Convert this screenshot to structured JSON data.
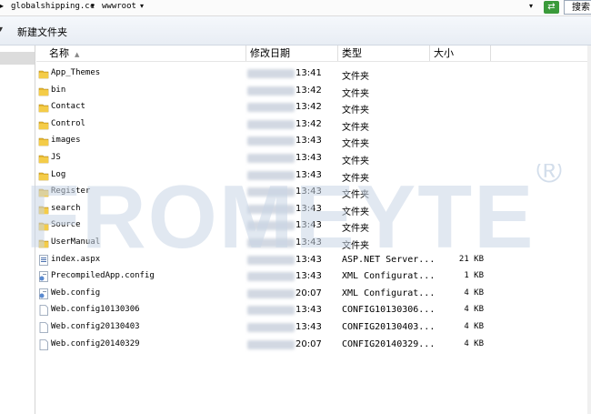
{
  "address": {
    "segments": [
      "globalshipping.cc",
      "wwwroot"
    ],
    "search_label": "搜索"
  },
  "toolbar": {
    "new_folder_label": "新建文件夹"
  },
  "columns": {
    "name": "名称",
    "date": "修改日期",
    "type": "类型",
    "size": "大小"
  },
  "files": [
    {
      "name": "App_Themes",
      "time": "13:41",
      "type": "文件夹",
      "size": "",
      "icon": "folder-icon"
    },
    {
      "name": "bin",
      "time": "13:42",
      "type": "文件夹",
      "size": "",
      "icon": "folder-icon"
    },
    {
      "name": "Contact",
      "time": "13:42",
      "type": "文件夹",
      "size": "",
      "icon": "folder-icon"
    },
    {
      "name": "Control",
      "time": "13:42",
      "type": "文件夹",
      "size": "",
      "icon": "folder-icon"
    },
    {
      "name": "images",
      "time": "13:43",
      "type": "文件夹",
      "size": "",
      "icon": "folder-icon"
    },
    {
      "name": "JS",
      "time": "13:43",
      "type": "文件夹",
      "size": "",
      "icon": "folder-icon"
    },
    {
      "name": "Log",
      "time": "13:43",
      "type": "文件夹",
      "size": "",
      "icon": "folder-icon"
    },
    {
      "name": "Register",
      "time": "13:43",
      "type": "文件夹",
      "size": "",
      "icon": "folder-icon"
    },
    {
      "name": "search",
      "time": "13:43",
      "type": "文件夹",
      "size": "",
      "icon": "folder-icon"
    },
    {
      "name": "Source",
      "time": "13:43",
      "type": "文件夹",
      "size": "",
      "icon": "folder-icon"
    },
    {
      "name": "UserManual",
      "time": "13:43",
      "type": "文件夹",
      "size": "",
      "icon": "folder-icon"
    },
    {
      "name": "index.aspx",
      "time": "13:43",
      "type": "ASP.NET Server...",
      "size": "21 KB",
      "icon": "aspx-file-icon"
    },
    {
      "name": "PrecompiledApp.config",
      "time": "13:43",
      "type": "XML Configurat...",
      "size": "1 KB",
      "icon": "config-file-icon"
    },
    {
      "name": "Web.config",
      "time": "20:07",
      "type": "XML Configurat...",
      "size": "4 KB",
      "icon": "config-file-icon"
    },
    {
      "name": "Web.config10130306",
      "time": "13:43",
      "type": "CONFIG10130306...",
      "size": "4 KB",
      "icon": "blank-file-icon"
    },
    {
      "name": "Web.config20130403",
      "time": "13:43",
      "type": "CONFIG20130403...",
      "size": "4 KB",
      "icon": "blank-file-icon"
    },
    {
      "name": "Web.config20140329",
      "time": "20:07",
      "type": "CONFIG20140329...",
      "size": "4 KB",
      "icon": "blank-file-icon"
    }
  ],
  "watermark": {
    "text": "FROMEYTE",
    "mark": "®"
  },
  "colors": {
    "folder": "#e8b830",
    "watermark": "#c8d6e6",
    "watermark_green": "#a8d8a0"
  }
}
